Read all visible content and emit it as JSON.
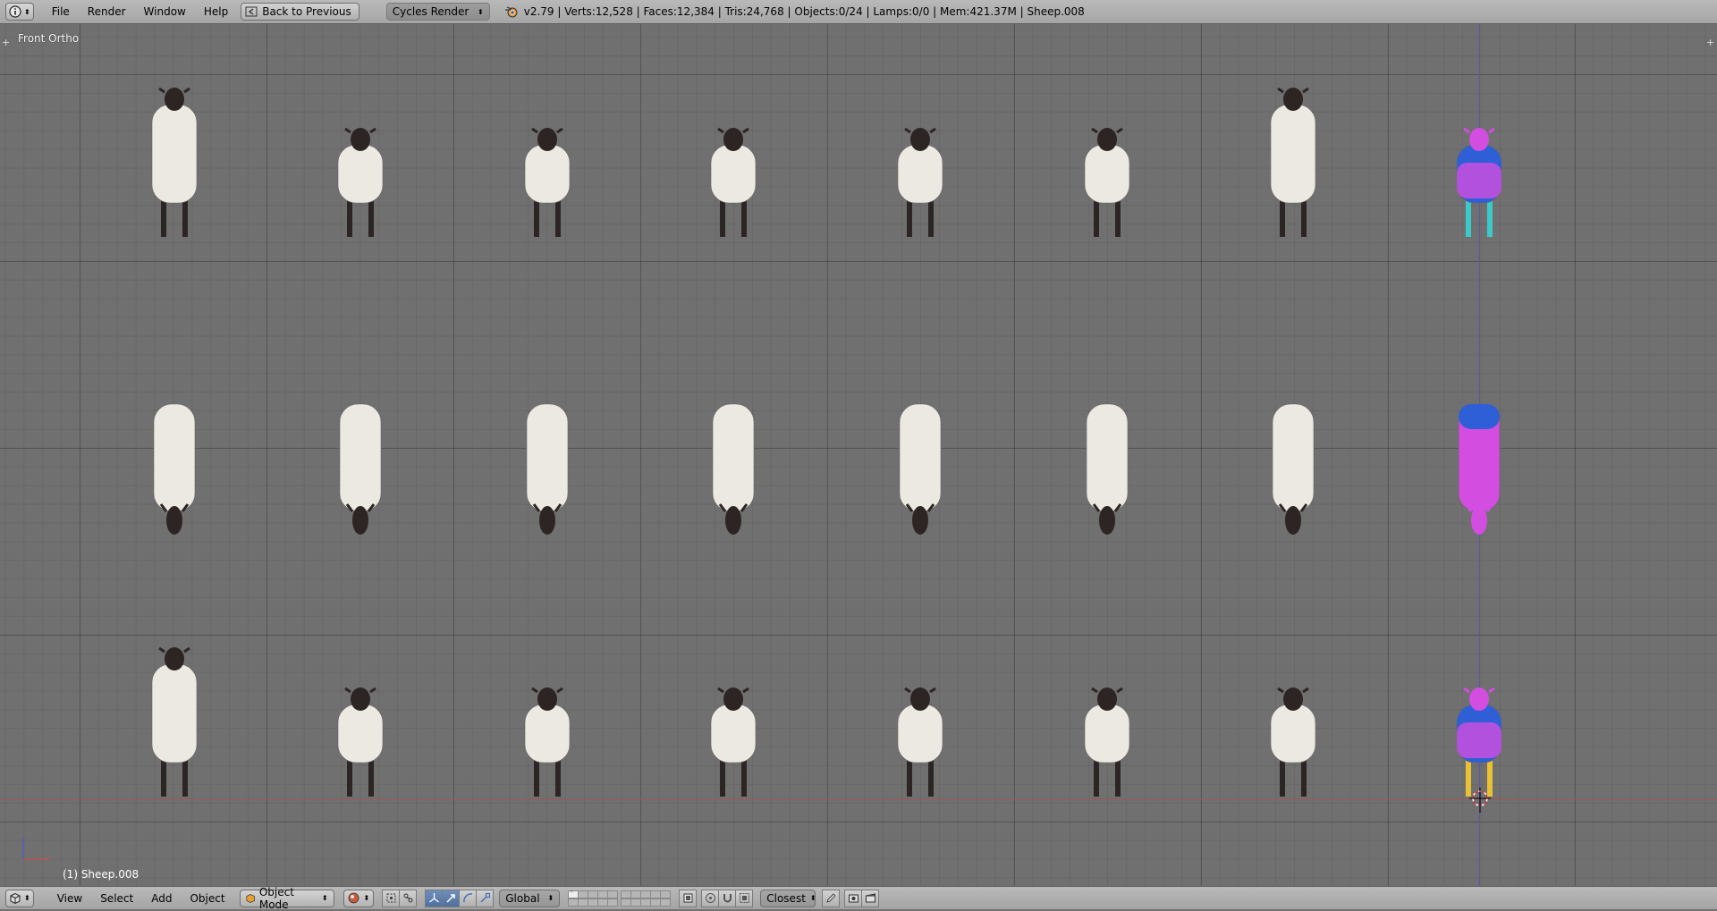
{
  "top_bar": {
    "menus": [
      "File",
      "Render",
      "Window",
      "Help"
    ],
    "back_button": "Back to Previous",
    "render_engine": "Cycles Render",
    "stats": "v2.79 | Verts:12,528 | Faces:12,384 | Tris:24,768 | Objects:0/24 | Lamps:0/0 | Mem:421.37M | Sheep.008"
  },
  "viewport": {
    "view_name": "Front Ortho",
    "active_object": "(1) Sheep.008"
  },
  "bottom_bar": {
    "menus": [
      "View",
      "Select",
      "Add",
      "Object"
    ],
    "mode": "Object Mode",
    "orientation": "Global",
    "snap_element": "Closest"
  },
  "colors": {
    "wool": "#ece9e2",
    "head": "#2d2524",
    "weight_blue": "#2f5fd6",
    "weight_magenta": "#d24de0",
    "weight_yellow": "#e8c233",
    "weight_cyan": "#3cc9c9",
    "x_axis": "#a05555",
    "z_axis": "#5858a8"
  },
  "icons": {
    "editor_type": "info-icon",
    "back": "back-arrow-icon",
    "engine": "blender-logo-icon",
    "viewport_shading": "solid-sphere-icon",
    "manipulator": "manipulator-icon",
    "snap": "magnet-icon",
    "render": "render-icon"
  }
}
